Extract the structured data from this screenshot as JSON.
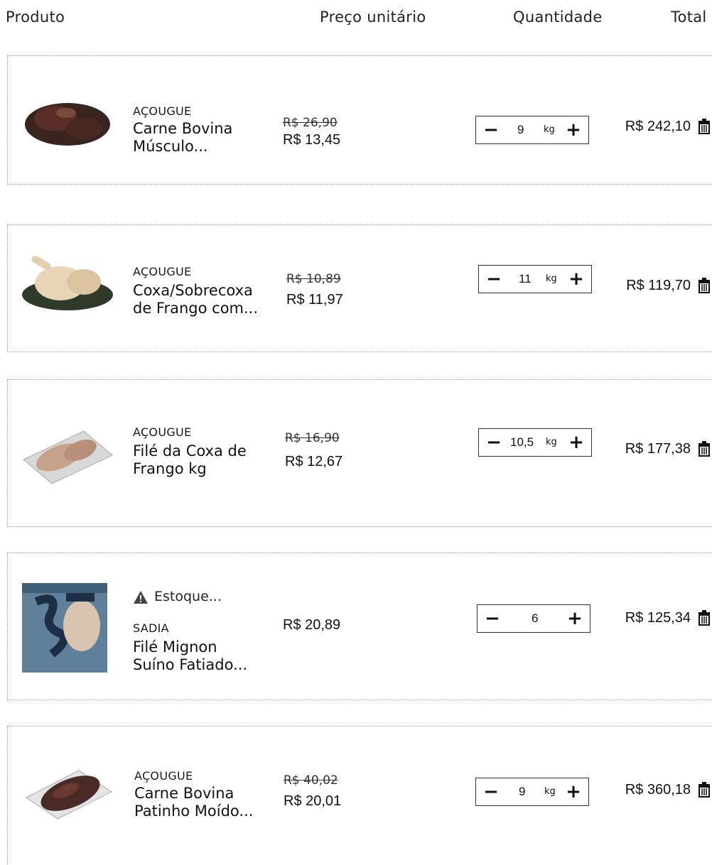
{
  "header": {
    "product": "Produto",
    "unit_price": "Preço unitário",
    "quantity": "Quantidade",
    "total": "Total"
  },
  "items": [
    {
      "image": "beef-shank-icon",
      "brand": "AÇOUGUE",
      "name_line1": "Carne Bovina",
      "name_line2": "Músculo...",
      "old_price": "R$ 26,90",
      "price": "R$ 13,45",
      "qty": "9",
      "unit": "kg",
      "total": "R$ 242,10"
    },
    {
      "image": "chicken-thigh-icon",
      "brand": "AÇOUGUE",
      "name_line1": "Coxa/Sobrecoxa",
      "name_line2": "de Frango com...",
      "old_price": "R$ 10,89",
      "price": "R$ 11,97",
      "qty": "11",
      "unit": "kg",
      "total": "R$ 119,70"
    },
    {
      "image": "chicken-fillet-tray-icon",
      "brand": "AÇOUGUE",
      "name_line1": "Filé da Coxa de",
      "name_line2": "Frango kg",
      "old_price": "R$ 16,90",
      "price": "R$ 12,67",
      "qty": "10,5",
      "unit": "kg",
      "total": "R$ 177,38"
    },
    {
      "image": "sadia-package-icon",
      "warning": "Estoque...",
      "brand": "SADIA",
      "name_line1": "Filé Mignon",
      "name_line2": "Suíno Fatiado...",
      "price": "R$ 20,89",
      "qty": "6",
      "total": "R$ 125,34"
    },
    {
      "image": "ground-beef-tray-icon",
      "brand": "AÇOUGUE",
      "name_line1": "Carne Bovina",
      "name_line2": "Patinho Moído...",
      "old_price": "R$ 40,02",
      "price": "R$ 20,01",
      "qty": "9",
      "unit": "kg",
      "total": "R$ 360,18"
    }
  ],
  "icons": {
    "minus": "−",
    "plus": "+",
    "delete": "trash-icon",
    "warning": "warning-triangle-icon"
  }
}
